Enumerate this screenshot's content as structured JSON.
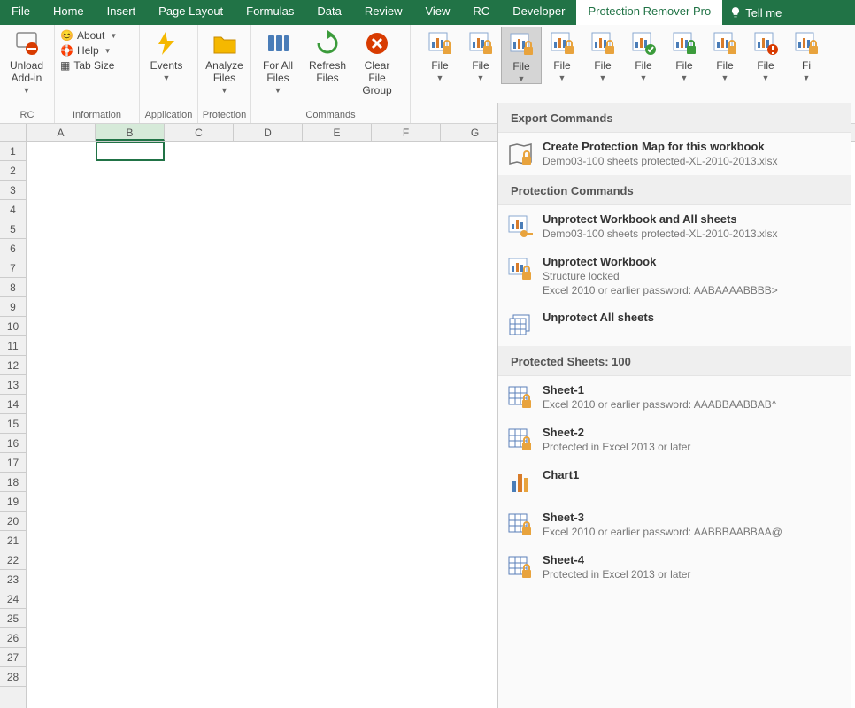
{
  "tabs": [
    "File",
    "Home",
    "Insert",
    "Page Layout",
    "Formulas",
    "Data",
    "Review",
    "View",
    "RC",
    "Developer",
    "Protection Remover Pro"
  ],
  "active_tab": "Protection Remover Pro",
  "tell_me": "Tell me",
  "ribbon": {
    "rc": {
      "unload": "Unload\nAdd-in",
      "label": "RC"
    },
    "info": {
      "about": "About",
      "help": "Help",
      "tabsize": "Tab Size",
      "label": "Information"
    },
    "app": {
      "events": "Events",
      "label": "Application"
    },
    "prot": {
      "analyze": "Analyze\nFiles",
      "label": "Protection"
    },
    "cmds": {
      "forall": "For All\nFiles",
      "refresh": "Refresh\nFiles",
      "clear": "Clear File\nGroup",
      "label": "Commands"
    },
    "filebtns": [
      {
        "label": "File",
        "active": false
      },
      {
        "label": "File",
        "active": false
      },
      {
        "label": "File",
        "active": true
      },
      {
        "label": "File",
        "active": false
      },
      {
        "label": "File",
        "active": false
      },
      {
        "label": "File",
        "active": false
      },
      {
        "label": "File",
        "active": false
      },
      {
        "label": "File",
        "active": false
      },
      {
        "label": "File",
        "active": false
      },
      {
        "label": "Fi",
        "active": false
      }
    ]
  },
  "columns": [
    "A",
    "B",
    "C",
    "D",
    "E",
    "F",
    "G"
  ],
  "selected_col": "B",
  "rowcount": 28,
  "menu": {
    "sec1": "Export Commands",
    "item1": {
      "title": "Create Protection Map for this workbook",
      "desc": "Demo03-100 sheets protected-XL-2010-2013.xlsx"
    },
    "sec2": "Protection Commands",
    "item2": {
      "title": "Unprotect Workbook and All sheets",
      "desc": "Demo03-100 sheets protected-XL-2010-2013.xlsx"
    },
    "item3": {
      "title": "Unprotect Workbook",
      "desc1": "Structure locked",
      "desc2": "Excel 2010 or earlier password: AABAAAABBBB>"
    },
    "item4": {
      "title": "Unprotect All sheets"
    },
    "sec3": "Protected Sheets: 100",
    "sheets": [
      {
        "title": "Sheet-1",
        "desc": "Excel 2010 or earlier password: AAABBAABBAB^",
        "icon": "sheet-lock"
      },
      {
        "title": "Sheet-2",
        "desc": "Protected in Excel 2013 or later",
        "icon": "sheet-lock"
      },
      {
        "title": "Chart1",
        "desc": "",
        "icon": "chart"
      },
      {
        "title": "Sheet-3",
        "desc": "Excel 2010 or earlier password: AABBBAABBAA@",
        "icon": "sheet-lock"
      },
      {
        "title": "Sheet-4",
        "desc": "Protected in Excel 2013 or later",
        "icon": "sheet-lock"
      }
    ]
  }
}
